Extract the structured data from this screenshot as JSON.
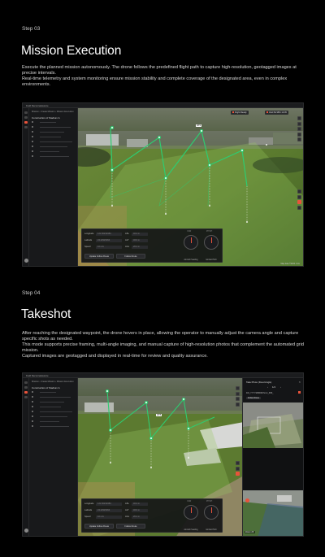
{
  "sections": [
    {
      "step": "Step 03",
      "title": "Mission Execution",
      "description": [
        "Execute the planned mission autonomously. The drone follows the predefined flight path to capture high-resolution, geotagged images at precise intervals.",
        "Real-time telemetry and system monitoring ensure mission stability and complete coverage of the designated area, even in complex environments."
      ]
    },
    {
      "step": "Step 04",
      "title": "Takeshot",
      "description": [
        "After reaching the designated waypoint, the drone hovers in place, allowing the operator to manually adjust the camera angle and capture specific shots as needed.",
        "This mode supports precise framing, multi-angle imaging, and manual capture of high-resolution photos that complement the automated grid mission.",
        "Captured images are geotagged and displayed in real-time for review and quality assurance."
      ]
    }
  ],
  "app": {
    "window_title": "Field Reconnaissance",
    "breadcrumbs": [
      "Mission",
      "Create Mission",
      "Mission Execution"
    ],
    "project": "Construction of Stadium A",
    "status_flight": "Flight Ready",
    "status_battery": "4G/LTE 98% 12:45",
    "map_footer": "Map data ©2024   1 km",
    "telemetry": [
      {
        "label": "Longitude",
        "value": "121.50232384",
        "unit_label": "ASL",
        "unit_value": "32.4 m"
      },
      {
        "label": "Latitude",
        "value": "24.22929394",
        "unit_label": "ALT",
        "unit_value": "32.0 m"
      },
      {
        "label": "Speed",
        "value": "10 m/s",
        "unit_label": "AGL",
        "unit_value": "26.4 m"
      }
    ],
    "buttons": {
      "update_route": "Update Follow Route",
      "follow_route": "Follow Route"
    },
    "dials": [
      {
        "title": "YAW",
        "label": "Aircraft Heading"
      },
      {
        "title": "PITCH",
        "label": "Gimbal Pitch"
      }
    ],
    "waypoint_labels": [
      "WP2",
      "WP5"
    ],
    "takeshot": {
      "header": "Take Photo (Fixed Angle)",
      "counter": "1/4",
      "filename": "DJI_YYYYMMDDhhmm_###_",
      "tag": "Follow Route",
      "zoom_label": "Zoom 2X"
    }
  },
  "colors": {
    "accent": "#e8533b",
    "route": "#2ecc71",
    "background": "#000000",
    "panel": "#18191b"
  }
}
